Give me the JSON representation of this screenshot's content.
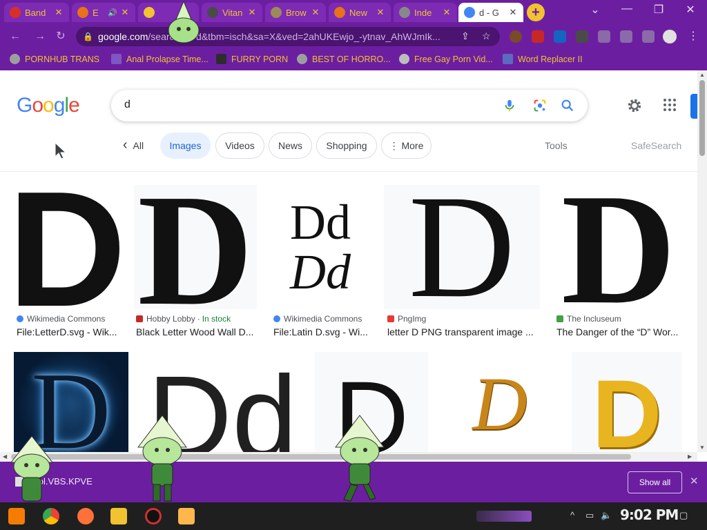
{
  "tabs": [
    {
      "title": "Band",
      "favicon_color": "#d93025",
      "active": false
    },
    {
      "title": "E",
      "favicon_color": "#e8711a",
      "active": false,
      "has_audio": true
    },
    {
      "title": "",
      "favicon_color": "#f2c230",
      "active": false
    },
    {
      "title": "Vitan",
      "favicon_color": "#4a4a4a",
      "active": false
    },
    {
      "title": "Brow",
      "favicon_color": "#9c8a5a",
      "active": false
    },
    {
      "title": "New",
      "favicon_color": "#e8711a",
      "active": false
    },
    {
      "title": "Inde",
      "favicon_color": "#888888",
      "active": false
    },
    {
      "title": "d - G",
      "favicon_color": "#4285f4",
      "active": true
    }
  ],
  "window_controls": {
    "dropdown": "⌄",
    "minimize": "—",
    "restore": "❐",
    "close": "✕"
  },
  "omnibox": {
    "host": "google.com",
    "path": "/search?q=d&tbm=isch&sa=X&ved=2ahUKEwjo_-ytnav_AhWJmIk..."
  },
  "bookmarks": [
    {
      "label": "PORNHUB TRANS",
      "icon_color": "#9e9e9e"
    },
    {
      "label": "Anal Prolapse Time...",
      "icon_color": "#7e57c2"
    },
    {
      "label": "FURRY PORN",
      "icon_color": "#2d2d2d"
    },
    {
      "label": "BEST OF HORRO...",
      "icon_color": "#9e9e9e"
    },
    {
      "label": "Free Gay Porn Vid...",
      "icon_color": "#bdbdbd"
    },
    {
      "label": "Word Replacer II",
      "icon_color": "#5c6bc0"
    }
  ],
  "google": {
    "logo_letters": [
      {
        "c": "G",
        "color": "#4285f4"
      },
      {
        "c": "o",
        "color": "#ea4335"
      },
      {
        "c": "o",
        "color": "#fbbc05"
      },
      {
        "c": "g",
        "color": "#4285f4"
      },
      {
        "c": "l",
        "color": "#34a853"
      },
      {
        "c": "e",
        "color": "#ea4335"
      }
    ],
    "query": "d",
    "filters": {
      "back": "‹",
      "all": "All",
      "images": "Images",
      "videos": "Videos",
      "news": "News",
      "shopping": "Shopping",
      "more": "⋮ More",
      "tools": "Tools",
      "safesearch": "SafeSearch"
    },
    "results_row1": [
      {
        "glyph": "D",
        "source": "Wikimedia Commons",
        "title": "File:LetterD.svg - Wik...",
        "source_color": "#4285f4"
      },
      {
        "glyph": "D",
        "source": "Hobby Lobby",
        "stock": "In stock",
        "title": "Black Letter Wood Wall D...",
        "source_color": "#c62828"
      },
      {
        "glyph": "Dd",
        "glyph2": "Dd",
        "source": "Wikimedia Commons",
        "title": "File:Latin D.svg - Wi...",
        "source_color": "#4285f4"
      },
      {
        "glyph": "D",
        "source": "PngImg",
        "title": "letter D PNG transparent image ...",
        "source_color": "#e53935"
      },
      {
        "glyph": "D",
        "source": "The Incluseum",
        "title": "The Danger of the “D” Wor...",
        "source_color": "#43a047"
      }
    ],
    "results_row2": [
      {
        "glyph": "D",
        "style": "electric"
      },
      {
        "glyph": "Dd",
        "style": "plain"
      },
      {
        "glyph": "D",
        "style": "plain"
      },
      {
        "glyph": "D",
        "style": "gold-script"
      },
      {
        "glyph": "D",
        "style": "gold-3d"
      }
    ]
  },
  "download_bar": {
    "file": "Tool.VBS.KPVE",
    "show_all": "Show all",
    "close": "✕"
  },
  "taskbar": {
    "clock": "9:02 PM",
    "apps": [
      {
        "name": "start",
        "color": "#f57c00"
      },
      {
        "name": "chrome",
        "color": "#4285f4"
      },
      {
        "name": "firefox",
        "color": "#ff7139"
      },
      {
        "name": "explorer",
        "color": "#f2c230"
      },
      {
        "name": "obs",
        "color": "#d32f2f"
      },
      {
        "name": "media",
        "color": "#ffb74d"
      }
    ]
  },
  "colors": {
    "chrome_purple": "#6b1fa0",
    "accent_yellow": "#f2c230",
    "google_blue": "#1a73e8",
    "peridot_green": "#8fd17a"
  }
}
